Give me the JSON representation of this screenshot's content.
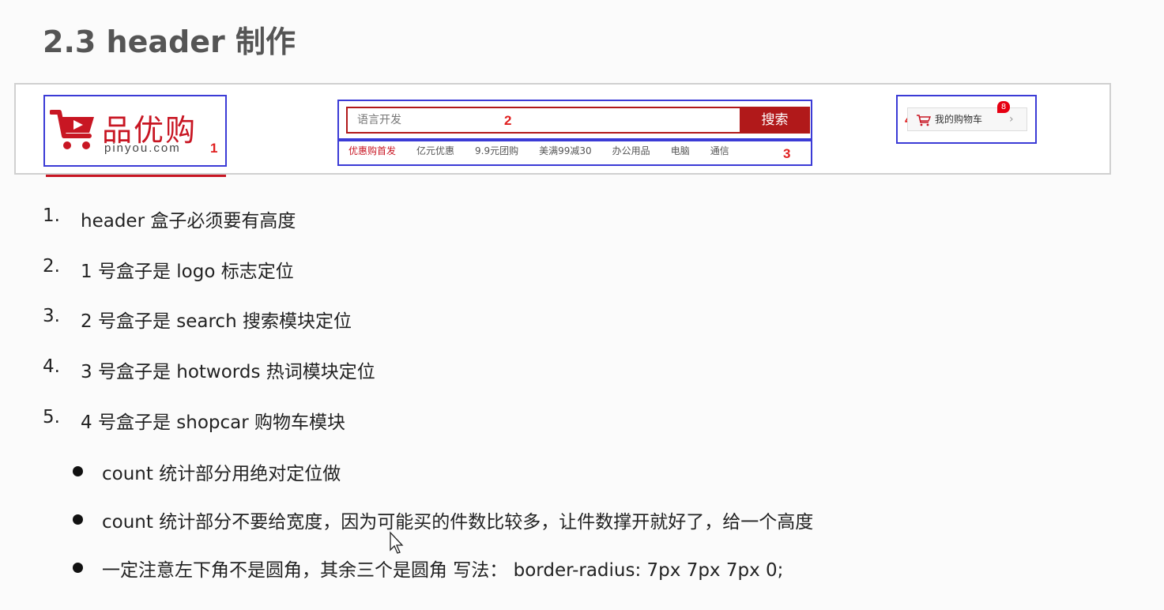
{
  "page_title": "2.3 header 制作",
  "demo": {
    "logo": {
      "name": "品优购",
      "domain": "pinyou.com",
      "label_num": "1"
    },
    "search": {
      "placeholder": "语言开发",
      "button": "搜索",
      "label_num": "2"
    },
    "hotwords": {
      "items": [
        "优惠购首发",
        "亿元优惠",
        "9.9元团购",
        "美满99减30",
        "办公用品",
        "电脑",
        "通信"
      ],
      "label_num": "3"
    },
    "shopcar": {
      "text": "我的购物车",
      "count": "8",
      "label_num": "4"
    },
    "accent": "#c81623",
    "box_color": "#3b3bd6"
  },
  "steps": [
    {
      "num": "1.",
      "text": "header 盒子必须要有高度"
    },
    {
      "num": "2.",
      "text": "1 号盒子是 logo 标志定位"
    },
    {
      "num": "3.",
      "text": "2 号盒子是 search 搜索模块定位"
    },
    {
      "num": "4.",
      "text": "3 号盒子是 hotwords  热词模块定位"
    },
    {
      "num": "5.",
      "text": "4 号盒子是 shopcar 购物车模块"
    }
  ],
  "bullets": [
    "count 统计部分用绝对定位做",
    "count 统计部分不要给宽度，因为可能买的件数比较多，让件数撑开就好了，给一个高度",
    "一定注意左下角不是圆角，其余三个是圆角  写法： border-radius: 7px 7px 7px 0;"
  ]
}
